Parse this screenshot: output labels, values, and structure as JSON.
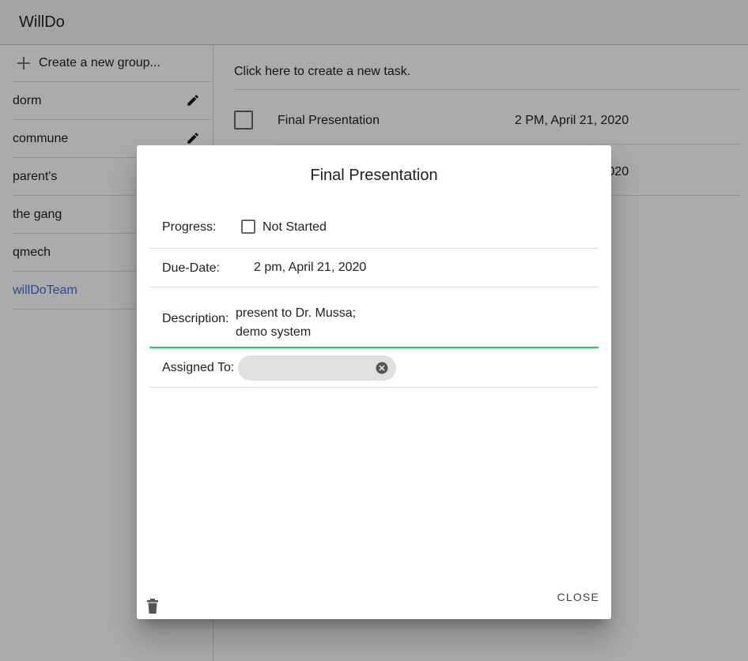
{
  "app": {
    "title": "WillDo"
  },
  "sidebar": {
    "create_label": "Create a new group...",
    "groups": [
      {
        "label": "dorm",
        "editable": true
      },
      {
        "label": "commune",
        "editable": true
      },
      {
        "label": "parent's",
        "editable": false
      },
      {
        "label": "the gang",
        "editable": false
      },
      {
        "label": "qmech",
        "editable": false
      },
      {
        "label": "willDoTeam",
        "editable": false,
        "selected": true
      }
    ]
  },
  "main": {
    "new_task_prompt": "Click here to create a new task.",
    "tasks": [
      {
        "name": "Final Presentation",
        "date": "2 PM, April 21, 2020",
        "done": false
      },
      {
        "name": "",
        "date": "2 PM, April 21, 2020",
        "done": false
      }
    ]
  },
  "dialog": {
    "title": "Final Presentation",
    "progress_label": "Progress:",
    "progress_status": "Not Started",
    "due_label": "Due-Date:",
    "due_value": "2 pm, April 21, 2020",
    "description_label": "Description:",
    "description_line1": "present to Dr. Mussa;",
    "description_line2": "demo system",
    "assigned_label": "Assigned To:",
    "close_label": "CLOSE"
  },
  "colors": {
    "selected_group": "#3f6fd8",
    "focus_underline": "#22c55e",
    "overlay": "rgba(0,0,0,0.33)"
  }
}
